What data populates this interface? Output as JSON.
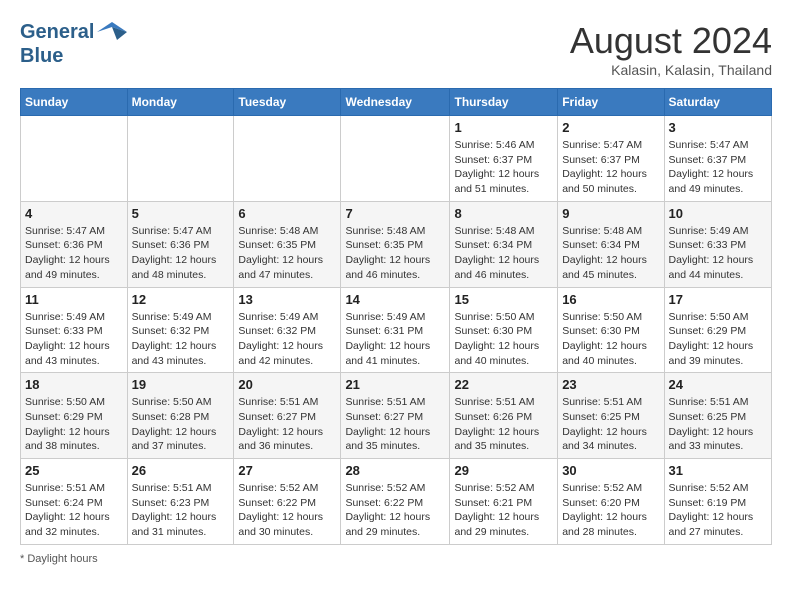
{
  "header": {
    "logo_line1": "General",
    "logo_line2": "Blue",
    "month_year": "August 2024",
    "location": "Kalasin, Kalasin, Thailand"
  },
  "days_of_week": [
    "Sunday",
    "Monday",
    "Tuesday",
    "Wednesday",
    "Thursday",
    "Friday",
    "Saturday"
  ],
  "weeks": [
    [
      {
        "day": "",
        "info": ""
      },
      {
        "day": "",
        "info": ""
      },
      {
        "day": "",
        "info": ""
      },
      {
        "day": "",
        "info": ""
      },
      {
        "day": "1",
        "info": "Sunrise: 5:46 AM\nSunset: 6:37 PM\nDaylight: 12 hours\nand 51 minutes."
      },
      {
        "day": "2",
        "info": "Sunrise: 5:47 AM\nSunset: 6:37 PM\nDaylight: 12 hours\nand 50 minutes."
      },
      {
        "day": "3",
        "info": "Sunrise: 5:47 AM\nSunset: 6:37 PM\nDaylight: 12 hours\nand 49 minutes."
      }
    ],
    [
      {
        "day": "4",
        "info": "Sunrise: 5:47 AM\nSunset: 6:36 PM\nDaylight: 12 hours\nand 49 minutes."
      },
      {
        "day": "5",
        "info": "Sunrise: 5:47 AM\nSunset: 6:36 PM\nDaylight: 12 hours\nand 48 minutes."
      },
      {
        "day": "6",
        "info": "Sunrise: 5:48 AM\nSunset: 6:35 PM\nDaylight: 12 hours\nand 47 minutes."
      },
      {
        "day": "7",
        "info": "Sunrise: 5:48 AM\nSunset: 6:35 PM\nDaylight: 12 hours\nand 46 minutes."
      },
      {
        "day": "8",
        "info": "Sunrise: 5:48 AM\nSunset: 6:34 PM\nDaylight: 12 hours\nand 46 minutes."
      },
      {
        "day": "9",
        "info": "Sunrise: 5:48 AM\nSunset: 6:34 PM\nDaylight: 12 hours\nand 45 minutes."
      },
      {
        "day": "10",
        "info": "Sunrise: 5:49 AM\nSunset: 6:33 PM\nDaylight: 12 hours\nand 44 minutes."
      }
    ],
    [
      {
        "day": "11",
        "info": "Sunrise: 5:49 AM\nSunset: 6:33 PM\nDaylight: 12 hours\nand 43 minutes."
      },
      {
        "day": "12",
        "info": "Sunrise: 5:49 AM\nSunset: 6:32 PM\nDaylight: 12 hours\nand 43 minutes."
      },
      {
        "day": "13",
        "info": "Sunrise: 5:49 AM\nSunset: 6:32 PM\nDaylight: 12 hours\nand 42 minutes."
      },
      {
        "day": "14",
        "info": "Sunrise: 5:49 AM\nSunset: 6:31 PM\nDaylight: 12 hours\nand 41 minutes."
      },
      {
        "day": "15",
        "info": "Sunrise: 5:50 AM\nSunset: 6:30 PM\nDaylight: 12 hours\nand 40 minutes."
      },
      {
        "day": "16",
        "info": "Sunrise: 5:50 AM\nSunset: 6:30 PM\nDaylight: 12 hours\nand 40 minutes."
      },
      {
        "day": "17",
        "info": "Sunrise: 5:50 AM\nSunset: 6:29 PM\nDaylight: 12 hours\nand 39 minutes."
      }
    ],
    [
      {
        "day": "18",
        "info": "Sunrise: 5:50 AM\nSunset: 6:29 PM\nDaylight: 12 hours\nand 38 minutes."
      },
      {
        "day": "19",
        "info": "Sunrise: 5:50 AM\nSunset: 6:28 PM\nDaylight: 12 hours\nand 37 minutes."
      },
      {
        "day": "20",
        "info": "Sunrise: 5:51 AM\nSunset: 6:27 PM\nDaylight: 12 hours\nand 36 minutes."
      },
      {
        "day": "21",
        "info": "Sunrise: 5:51 AM\nSunset: 6:27 PM\nDaylight: 12 hours\nand 35 minutes."
      },
      {
        "day": "22",
        "info": "Sunrise: 5:51 AM\nSunset: 6:26 PM\nDaylight: 12 hours\nand 35 minutes."
      },
      {
        "day": "23",
        "info": "Sunrise: 5:51 AM\nSunset: 6:25 PM\nDaylight: 12 hours\nand 34 minutes."
      },
      {
        "day": "24",
        "info": "Sunrise: 5:51 AM\nSunset: 6:25 PM\nDaylight: 12 hours\nand 33 minutes."
      }
    ],
    [
      {
        "day": "25",
        "info": "Sunrise: 5:51 AM\nSunset: 6:24 PM\nDaylight: 12 hours\nand 32 minutes."
      },
      {
        "day": "26",
        "info": "Sunrise: 5:51 AM\nSunset: 6:23 PM\nDaylight: 12 hours\nand 31 minutes."
      },
      {
        "day": "27",
        "info": "Sunrise: 5:52 AM\nSunset: 6:22 PM\nDaylight: 12 hours\nand 30 minutes."
      },
      {
        "day": "28",
        "info": "Sunrise: 5:52 AM\nSunset: 6:22 PM\nDaylight: 12 hours\nand 29 minutes."
      },
      {
        "day": "29",
        "info": "Sunrise: 5:52 AM\nSunset: 6:21 PM\nDaylight: 12 hours\nand 29 minutes."
      },
      {
        "day": "30",
        "info": "Sunrise: 5:52 AM\nSunset: 6:20 PM\nDaylight: 12 hours\nand 28 minutes."
      },
      {
        "day": "31",
        "info": "Sunrise: 5:52 AM\nSunset: 6:19 PM\nDaylight: 12 hours\nand 27 minutes."
      }
    ]
  ],
  "footer": {
    "note": "Daylight hours"
  }
}
